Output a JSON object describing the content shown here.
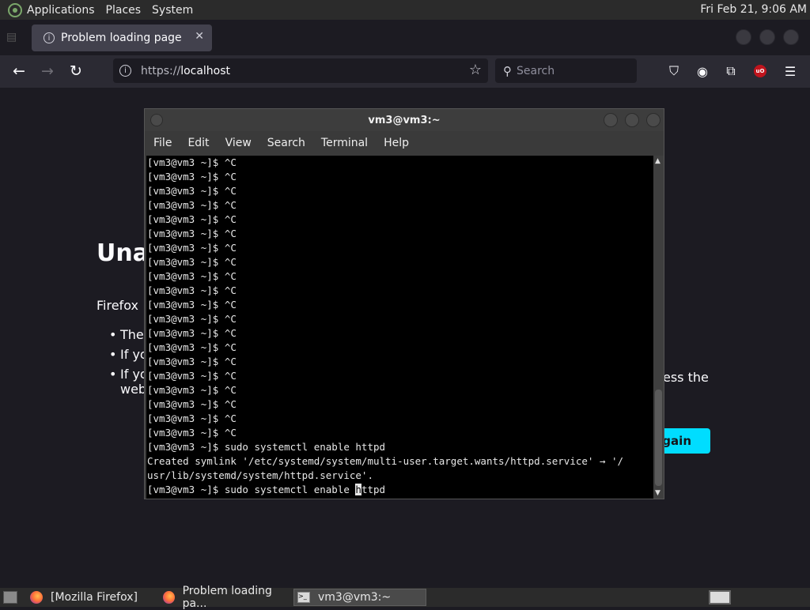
{
  "top_panel": {
    "menus": [
      "Applications",
      "Places",
      "System"
    ],
    "clock": "Fri Feb 21,  9:06 AM"
  },
  "firefox": {
    "tab_title": "Problem loading page",
    "url": "https://localhost",
    "url_proto": "https://",
    "url_host": "localhost",
    "search_placeholder": "Search",
    "error": {
      "title": "Una",
      "intro": "Firefox",
      "bullets": [
        "The",
        "If yo",
        "If yo"
      ],
      "bullet3_line2": "web",
      "tail_text": "ess the",
      "try_again_label": "Again"
    }
  },
  "terminal": {
    "title": "vm3@vm3:~",
    "menu": [
      "File",
      "Edit",
      "View",
      "Search",
      "Terminal",
      "Help"
    ],
    "lines": [
      "[vm3@vm3 ~]$ ^C",
      "[vm3@vm3 ~]$ ^C",
      "[vm3@vm3 ~]$ ^C",
      "[vm3@vm3 ~]$ ^C",
      "[vm3@vm3 ~]$ ^C",
      "[vm3@vm3 ~]$ ^C",
      "[vm3@vm3 ~]$ ^C",
      "[vm3@vm3 ~]$ ^C",
      "[vm3@vm3 ~]$ ^C",
      "[vm3@vm3 ~]$ ^C",
      "[vm3@vm3 ~]$ ^C",
      "[vm3@vm3 ~]$ ^C",
      "[vm3@vm3 ~]$ ^C",
      "[vm3@vm3 ~]$ ^C",
      "[vm3@vm3 ~]$ ^C",
      "[vm3@vm3 ~]$ ^C",
      "[vm3@vm3 ~]$ ^C",
      "[vm3@vm3 ~]$ ^C",
      "[vm3@vm3 ~]$ ^C",
      "[vm3@vm3 ~]$ ^C",
      "[vm3@vm3 ~]$ sudo systemctl enable httpd",
      "Created symlink '/etc/systemd/system/multi-user.target.wants/httpd.service' → '/",
      "usr/lib/systemd/system/httpd.service'."
    ],
    "input_before_cursor": "[vm3@vm3 ~]$ sudo systemctl enable ",
    "input_cursor_char": "h",
    "input_after_cursor": "ttpd"
  },
  "taskbar": {
    "tasks": [
      "[Mozilla Firefox]",
      "Problem loading pa...",
      "vm3@vm3:~"
    ]
  }
}
